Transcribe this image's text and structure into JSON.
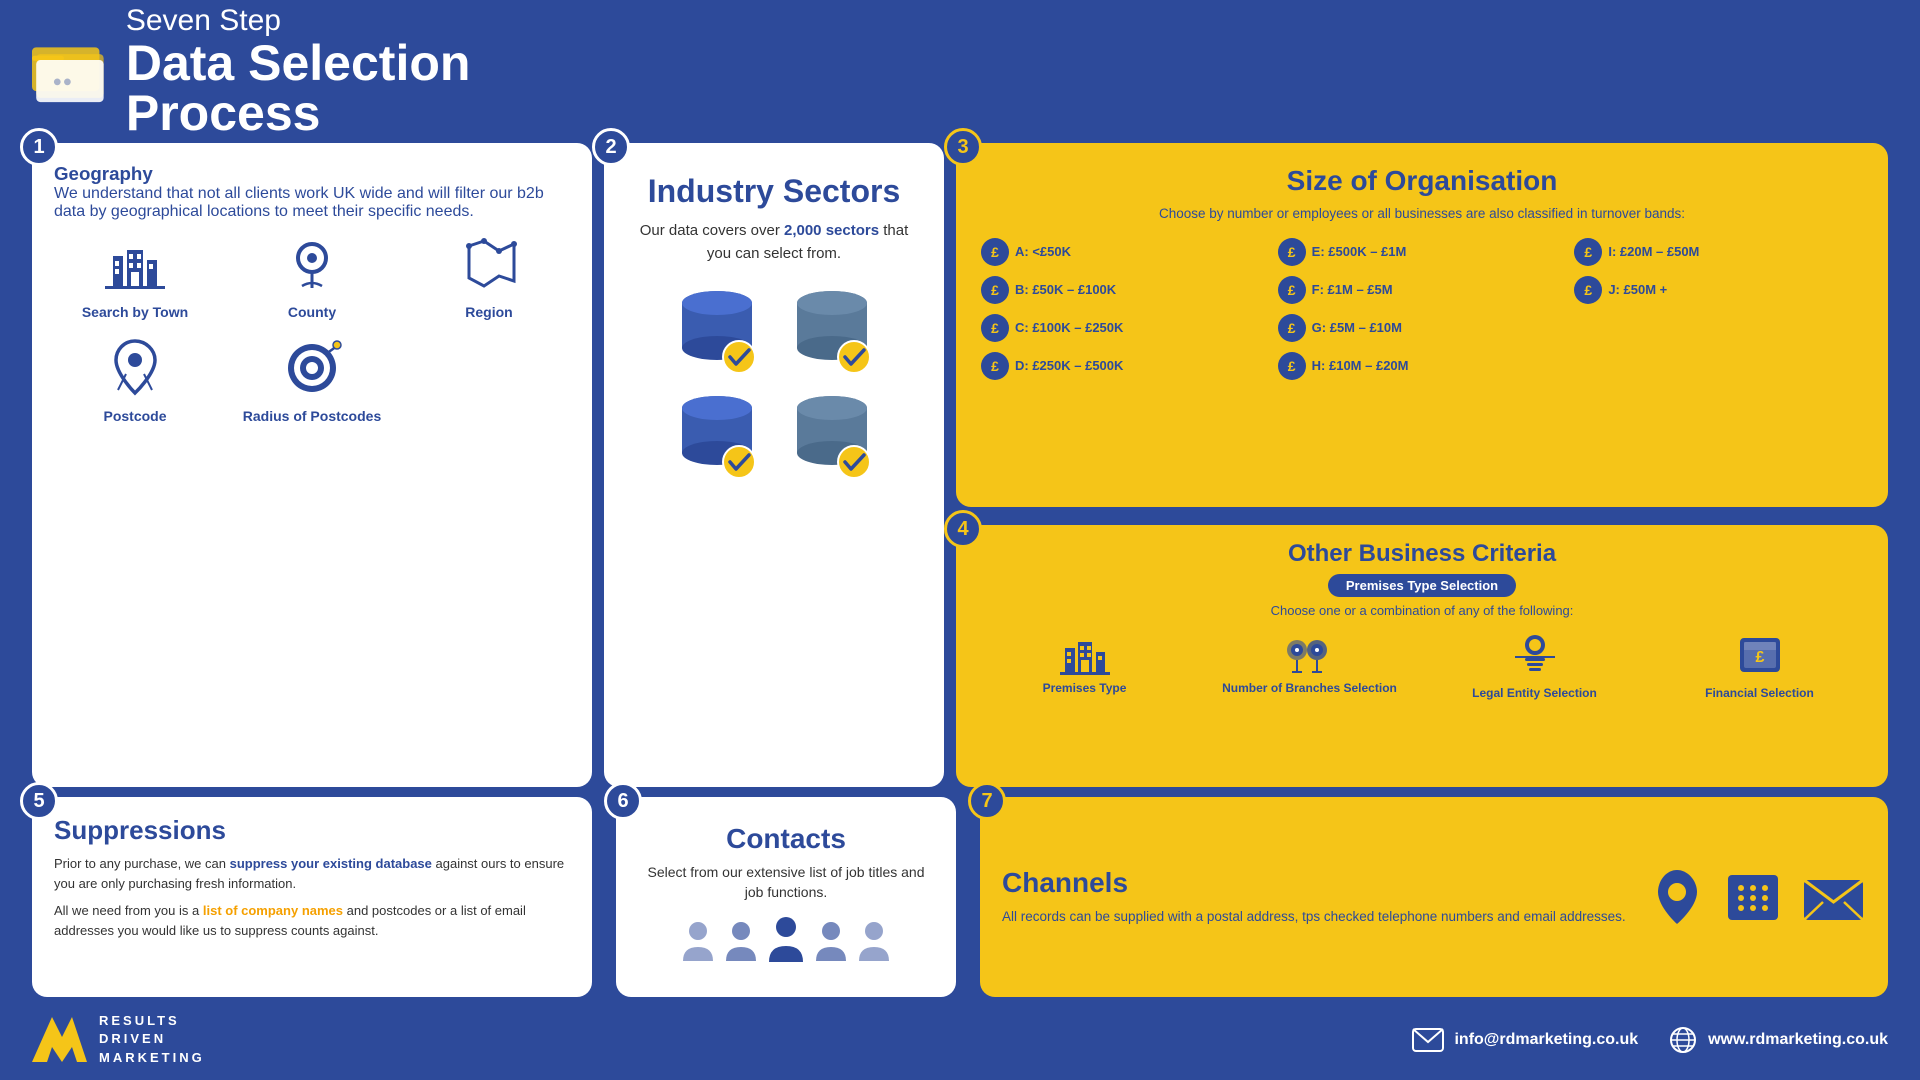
{
  "header": {
    "subtitle": "Seven Step",
    "title": "Data Selection Process"
  },
  "step1": {
    "number": "1",
    "title": "Geography",
    "description": "We understand that not all clients work UK wide and will filter our b2b data by geographical locations to meet their specific needs.",
    "geo_items": [
      {
        "label": "Search by Town",
        "icon": "building"
      },
      {
        "label": "County",
        "icon": "pin"
      },
      {
        "label": "Region",
        "icon": "region"
      },
      {
        "label": "Postcode",
        "icon": "postcode"
      },
      {
        "label": "Radius of Postcodes",
        "icon": "radius"
      }
    ]
  },
  "step2": {
    "number": "2",
    "title": "Industry Sectors",
    "description": "Our data covers over 2,000 sectors that you can select from.",
    "bold_text": "2,000 sectors"
  },
  "step3": {
    "number": "3",
    "title": "Size of Organisation",
    "subtitle": "Choose by number or employees or all businesses are also classified in turnover bands:",
    "bands": [
      {
        "label": "A: <£50K"
      },
      {
        "label": "E: £500K – £1M"
      },
      {
        "label": "I: £20M – £50M"
      },
      {
        "label": "B: £50K – £100K"
      },
      {
        "label": "F: £1M – £5M"
      },
      {
        "label": "J: £50M +"
      },
      {
        "label": "C: £100K – £250K"
      },
      {
        "label": "G: £5M – £10M"
      },
      {
        "label": ""
      },
      {
        "label": "D: £250K – £500K"
      },
      {
        "label": "H: £10M – £20M"
      },
      {
        "label": ""
      }
    ]
  },
  "step4": {
    "number": "4",
    "title": "Other Business Criteria",
    "badge": "Premises Type Selection",
    "choose_text": "Choose one or a combination of any of the following:",
    "criteria": [
      {
        "label": "Premises Type"
      },
      {
        "label": "Number of Branches Selection"
      },
      {
        "label": "Legal Entity Selection"
      },
      {
        "label": "Financial Selection"
      }
    ]
  },
  "step5": {
    "number": "5",
    "title": "Suppressions",
    "para1_start": "Prior to any purchase, we can ",
    "para1_highlight": "suppress your existing database",
    "para1_end": " against ours to ensure you are only purchasing fresh information.",
    "para2_start": "All we need from you is a ",
    "para2_highlight": "list of company names",
    "para2_end": " and postcodes or a list of email addresses you would like us to suppress counts against."
  },
  "step6": {
    "number": "6",
    "title": "Contacts",
    "description": "Select from our extensive list of job titles and job functions."
  },
  "step7": {
    "number": "7",
    "title": "Channels",
    "description": "All records can be supplied with a postal address, tps checked telephone numbers and email addresses."
  },
  "footer": {
    "logo_lines": [
      "RESULTS",
      "DRIVEN",
      "MARKETING"
    ],
    "email_label": "info@rdmarketing.co.uk",
    "web_label": "www.rdmarketing.co.uk"
  }
}
